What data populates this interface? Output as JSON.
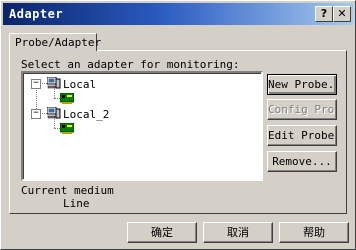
{
  "window": {
    "title": "Adapter",
    "help_label": "?",
    "close_label": "✕"
  },
  "tabs": [
    {
      "label": "Probe/Adapter"
    }
  ],
  "panel": {
    "select_label": "Select an adapter for monitoring:",
    "tree": [
      {
        "label": "Local",
        "expander": "−"
      },
      {
        "label": "Local_2",
        "expander": "−"
      }
    ],
    "side_buttons": {
      "new_probe": "New Probe...",
      "config_probe": "Config Probe...",
      "edit_probe": "Edit Probe...",
      "remove": "Remove..."
    },
    "medium_label": "Current medium",
    "medium_value": "Line"
  },
  "footer": {
    "ok": "确定",
    "cancel": "取消",
    "help": "帮助"
  }
}
